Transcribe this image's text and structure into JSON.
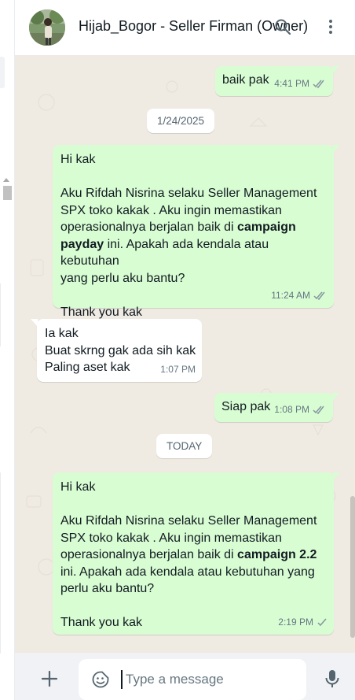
{
  "header": {
    "contact_name": "Hijab_Bogor - Seller Firman (Owner)"
  },
  "messages": [
    {
      "direction": "out",
      "text": "baik pak",
      "time": "4:41 PM",
      "status": "read"
    },
    {
      "type": "date",
      "label": "1/24/2025"
    },
    {
      "direction": "out",
      "line1": "Hi kak",
      "line2": "Aku Rifdah Nisrina selaku Seller Management",
      "line3": "SPX toko kakak . Aku ingin memastikan",
      "line4a": "operasionalnya berjalan baik di ",
      "line4b": "campaign",
      "line5a": "payday",
      "line5b": " ini. Apakah ada kendala atau kebutuhan",
      "line6": "yang perlu aku bantu?",
      "line7": "Thank you kak",
      "time": "11:24 AM",
      "status": "read"
    },
    {
      "direction": "in",
      "line1": "Ia kak",
      "line2": "Buat skrng gak ada sih kak",
      "line3": "Paling aset kak",
      "time": "1:07 PM"
    },
    {
      "direction": "out",
      "text": "Siap pak",
      "time": "1:08 PM",
      "status": "read"
    },
    {
      "type": "date",
      "label": "TODAY"
    },
    {
      "direction": "out",
      "line1": "Hi kak",
      "line2": "Aku Rifdah Nisrina selaku Seller Management",
      "line3": "SPX toko kakak . Aku ingin memastikan",
      "line4a": "operasionalnya berjalan baik di ",
      "line4b": "campaign 2.2",
      "line5": "ini. Apakah ada kendala atau kebutuhan yang",
      "line6": "perlu aku bantu?",
      "line7": "Thank you kak",
      "time": "2:19 PM",
      "status": "sent"
    }
  ],
  "composer": {
    "placeholder": "Type a message"
  },
  "colors": {
    "outgoing_bubble": "#d9fdd3",
    "incoming_bubble": "#ffffff",
    "chat_background": "#efeae2",
    "read_tick": "#8696a0"
  },
  "icons": [
    "avatar",
    "search-icon",
    "menu-icon",
    "plus-icon",
    "sticker-icon",
    "mic-icon",
    "double-check-icon",
    "single-check-icon"
  ]
}
